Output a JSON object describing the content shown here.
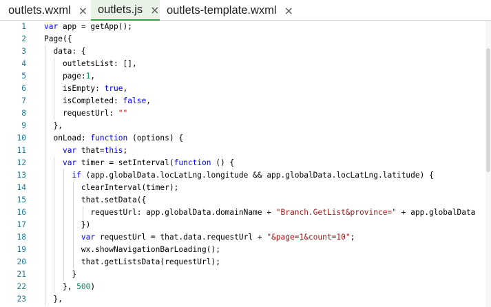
{
  "tabs": [
    {
      "label": "outlets.wxml",
      "close": "×",
      "active": false
    },
    {
      "label": "outlets.js",
      "close": "×",
      "active": true
    },
    {
      "label": "outlets-template.wxml",
      "close": "×",
      "active": false
    }
  ],
  "line_numbers": [
    "1",
    "2",
    "3",
    "4",
    "5",
    "6",
    "7",
    "8",
    "9",
    "10",
    "11",
    "12",
    "13",
    "14",
    "15",
    "16",
    "17",
    "18",
    "19",
    "20",
    "21",
    "22",
    "23"
  ],
  "code_lines": [
    [
      {
        "t": "var",
        "c": "kw"
      },
      {
        "t": " app = getApp();",
        "c": ""
      }
    ],
    [
      {
        "t": "Page({",
        "c": ""
      }
    ],
    [
      {
        "t": "  data: {",
        "c": ""
      }
    ],
    [
      {
        "t": "    outletsList: [],",
        "c": ""
      }
    ],
    [
      {
        "t": "    page:",
        "c": ""
      },
      {
        "t": "1",
        "c": "num"
      },
      {
        "t": ",",
        "c": ""
      }
    ],
    [
      {
        "t": "    isEmpty: ",
        "c": ""
      },
      {
        "t": "true",
        "c": "kw"
      },
      {
        "t": ",",
        "c": ""
      }
    ],
    [
      {
        "t": "    isCompleted: ",
        "c": ""
      },
      {
        "t": "false",
        "c": "kw"
      },
      {
        "t": ",",
        "c": ""
      }
    ],
    [
      {
        "t": "    requestUrl: ",
        "c": ""
      },
      {
        "t": "\"\"",
        "c": "str"
      }
    ],
    [
      {
        "t": "  },",
        "c": ""
      }
    ],
    [
      {
        "t": "  onLoad: ",
        "c": ""
      },
      {
        "t": "function",
        "c": "kw"
      },
      {
        "t": " (options) {",
        "c": ""
      }
    ],
    [
      {
        "t": "    ",
        "c": ""
      },
      {
        "t": "var",
        "c": "kw"
      },
      {
        "t": " that=",
        "c": ""
      },
      {
        "t": "this",
        "c": "kw"
      },
      {
        "t": ";",
        "c": ""
      }
    ],
    [
      {
        "t": "    ",
        "c": ""
      },
      {
        "t": "var",
        "c": "kw"
      },
      {
        "t": " timer = setInterval(",
        "c": ""
      },
      {
        "t": "function",
        "c": "kw"
      },
      {
        "t": " () {",
        "c": ""
      }
    ],
    [
      {
        "t": "      ",
        "c": ""
      },
      {
        "t": "if",
        "c": "kw"
      },
      {
        "t": " (app.globalData.locLatLng.longitude && app.globalData.locLatLng.latitude) {",
        "c": ""
      }
    ],
    [
      {
        "t": "        clearInterval(timer);",
        "c": ""
      }
    ],
    [
      {
        "t": "        that.setData({",
        "c": ""
      }
    ],
    [
      {
        "t": "          requestUrl: app.globalData.domainName + ",
        "c": ""
      },
      {
        "t": "\"Branch.GetList&province=\"",
        "c": "str"
      },
      {
        "t": " + app.globalData",
        "c": ""
      }
    ],
    [
      {
        "t": "        })",
        "c": ""
      }
    ],
    [
      {
        "t": "        ",
        "c": ""
      },
      {
        "t": "var",
        "c": "kw"
      },
      {
        "t": " requestUrl = that.data.requestUrl + ",
        "c": ""
      },
      {
        "t": "\"&page=1&count=10\"",
        "c": "str"
      },
      {
        "t": ";",
        "c": ""
      }
    ],
    [
      {
        "t": "        wx.showNavigationBarLoading();",
        "c": ""
      }
    ],
    [
      {
        "t": "        that.getListsData(requestUrl);",
        "c": ""
      }
    ],
    [
      {
        "t": "      }",
        "c": ""
      }
    ],
    [
      {
        "t": "    }, ",
        "c": ""
      },
      {
        "t": "500",
        "c": "num"
      },
      {
        "t": ")",
        "c": ""
      }
    ],
    [
      {
        "t": "  },",
        "c": ""
      }
    ]
  ],
  "colors": {
    "keyword": "#0000ff",
    "string": "#a31515",
    "number": "#098658",
    "line_number": "#237893",
    "active_tab_bg": "#e8f2e6",
    "active_tab_underline": "#3b9b3f"
  },
  "icons": {
    "tab_close": "close-icon"
  }
}
